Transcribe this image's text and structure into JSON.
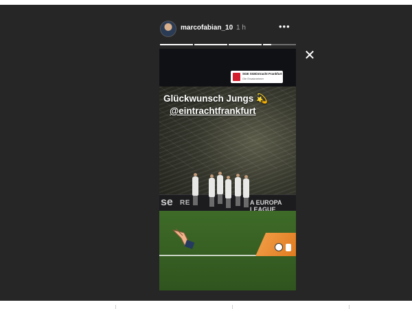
{
  "header": {
    "username": "marcofabian_10",
    "time": "1 h",
    "more_label": "•••"
  },
  "progress": {
    "segments": [
      1.0,
      1.0,
      1.0,
      0.25
    ]
  },
  "close_label": "✕",
  "story": {
    "sticker": {
      "title": "SGE SGEintracht Frankfurt",
      "subtitle": "Ole Ersatzneimer"
    },
    "caption_line1": "Glückwunsch Jungs 💫",
    "caption_line2": "@eintrachtfrankfurt",
    "board_text_left": "se",
    "board_text_middle": "RE",
    "board_text_right": "A EUROPA LEAGUE"
  },
  "colors": {
    "background": "#262626",
    "accent_orange": "#e07b1f",
    "pitch_green": "#3e6b28"
  }
}
